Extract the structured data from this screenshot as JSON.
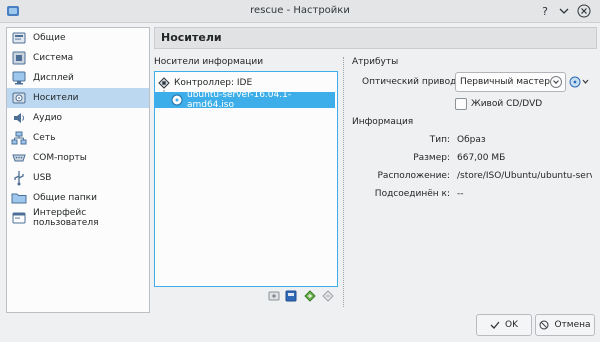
{
  "window": {
    "title": "rescue - Настройки"
  },
  "sidebar": {
    "items": [
      {
        "label": "Общие",
        "icon": "general-settings-icon"
      },
      {
        "label": "Система",
        "icon": "system-motherboard-icon"
      },
      {
        "label": "Дисплей",
        "icon": "display-monitor-icon"
      },
      {
        "label": "Носители",
        "icon": "storage-disk-icon",
        "active": true
      },
      {
        "label": "Аудио",
        "icon": "audio-speaker-icon"
      },
      {
        "label": "Сеть",
        "icon": "network-icon"
      },
      {
        "label": "COM-порты",
        "icon": "serial-port-icon"
      },
      {
        "label": "USB",
        "icon": "usb-icon"
      },
      {
        "label": "Общие папки",
        "icon": "shared-folder-icon"
      },
      {
        "label": "Интерфейс пользователя",
        "icon": "user-interface-icon"
      }
    ]
  },
  "section": {
    "title": "Носители"
  },
  "storage": {
    "label": "Носители информации",
    "controller": "Контроллер: IDE",
    "attachment": "ubuntu-server-16.04.1-amd64.iso"
  },
  "attributes": {
    "heading": "Атрибуты",
    "drive_label": "Оптический привод:",
    "drive_value": "Первичный мастер IDE",
    "live_cd_label": "Живой CD/DVD",
    "live_cd_checked": false
  },
  "info": {
    "heading": "Информация",
    "type_label": "Тип:",
    "type_value": "Образ",
    "size_label": "Размер:",
    "size_value": "667,00 МБ",
    "location_label": "Расположение:",
    "location_value": "/store/ISO/Ubuntu/ubuntu-serv...",
    "attached_label": "Подсоединён к:",
    "attached_value": "--"
  },
  "buttons": {
    "ok": "OK",
    "cancel": "Отмена"
  },
  "colors": {
    "accent": "#3daee9",
    "selection": "#bcd8f0",
    "window_bg": "#eff0f1"
  }
}
